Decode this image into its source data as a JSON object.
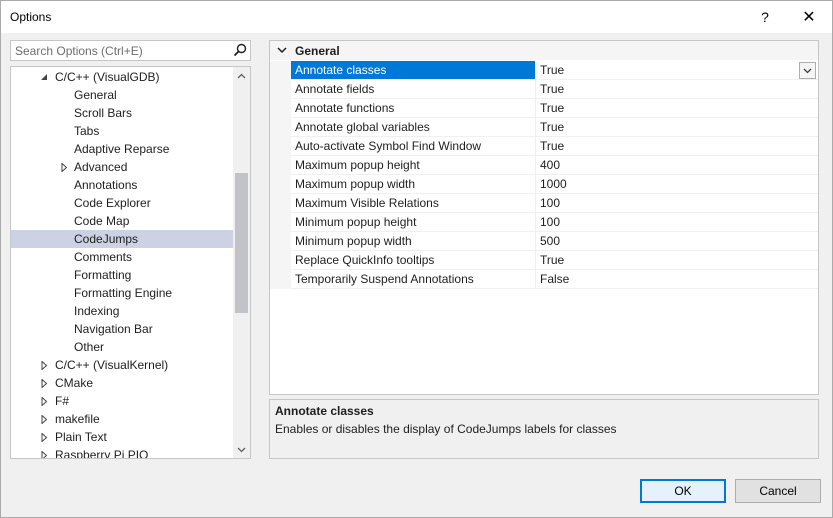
{
  "window": {
    "title": "Options",
    "help_glyph": "?",
    "close_glyph": "✕"
  },
  "search": {
    "placeholder": "Search Options (Ctrl+E)",
    "icon": "search-icon"
  },
  "tree": {
    "items": [
      {
        "label": "C/C++ (VisualGDB)",
        "level": 1,
        "expander": "expanded"
      },
      {
        "label": "General",
        "level": 2,
        "expander": "none"
      },
      {
        "label": "Scroll Bars",
        "level": 2,
        "expander": "none"
      },
      {
        "label": "Tabs",
        "level": 2,
        "expander": "none"
      },
      {
        "label": "Adaptive Reparse",
        "level": 2,
        "expander": "none"
      },
      {
        "label": "Advanced",
        "level": 2,
        "expander": "collapsed"
      },
      {
        "label": "Annotations",
        "level": 2,
        "expander": "none"
      },
      {
        "label": "Code Explorer",
        "level": 2,
        "expander": "none"
      },
      {
        "label": "Code Map",
        "level": 2,
        "expander": "none"
      },
      {
        "label": "CodeJumps",
        "level": 2,
        "expander": "none",
        "selected": true
      },
      {
        "label": "Comments",
        "level": 2,
        "expander": "none"
      },
      {
        "label": "Formatting",
        "level": 2,
        "expander": "none"
      },
      {
        "label": "Formatting Engine",
        "level": 2,
        "expander": "none"
      },
      {
        "label": "Indexing",
        "level": 2,
        "expander": "none"
      },
      {
        "label": "Navigation Bar",
        "level": 2,
        "expander": "none"
      },
      {
        "label": "Other",
        "level": 2,
        "expander": "none"
      },
      {
        "label": "C/C++ (VisualKernel)",
        "level": 1,
        "expander": "collapsed"
      },
      {
        "label": "CMake",
        "level": 1,
        "expander": "collapsed"
      },
      {
        "label": "F#",
        "level": 1,
        "expander": "collapsed"
      },
      {
        "label": "makefile",
        "level": 1,
        "expander": "collapsed"
      },
      {
        "label": "Plain Text",
        "level": 1,
        "expander": "collapsed"
      },
      {
        "label": "Raspberry Pi PIO",
        "level": 1,
        "expander": "collapsed"
      }
    ]
  },
  "grid": {
    "category": "General",
    "properties": [
      {
        "name": "Annotate classes",
        "value": "True",
        "selected": true
      },
      {
        "name": "Annotate fields",
        "value": "True"
      },
      {
        "name": "Annotate functions",
        "value": "True"
      },
      {
        "name": "Annotate global variables",
        "value": "True"
      },
      {
        "name": "Auto-activate Symbol Find Window",
        "value": "True"
      },
      {
        "name": "Maximum popup height",
        "value": "400"
      },
      {
        "name": "Maximum popup width",
        "value": "1000"
      },
      {
        "name": "Maximum Visible Relations",
        "value": "100"
      },
      {
        "name": "Minimum popup height",
        "value": "100"
      },
      {
        "name": "Minimum popup width",
        "value": "500"
      },
      {
        "name": "Replace QuickInfo tooltips",
        "value": "True"
      },
      {
        "name": "Temporarily Suspend Annotations",
        "value": "False"
      }
    ]
  },
  "description": {
    "title": "Annotate classes",
    "text": "Enables or disables the display of CodeJumps labels for classes"
  },
  "buttons": {
    "ok": "OK",
    "cancel": "Cancel"
  },
  "colors": {
    "selection_accent": "#0078d7",
    "tree_selection": "#ccd2e4"
  }
}
